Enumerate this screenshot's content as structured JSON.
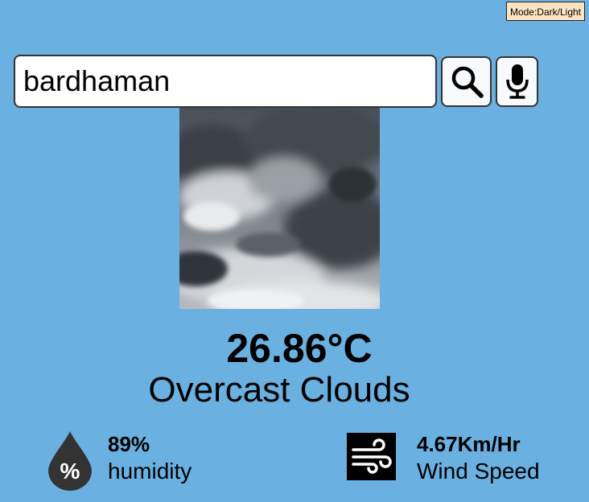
{
  "mode_toggle": {
    "label": "Mode:Dark/Light"
  },
  "search": {
    "value": "bardhaman"
  },
  "buttons": {
    "search_icon": "magnifier",
    "mic_icon": "microphone"
  },
  "weather": {
    "image": "overcast-clouds-photo",
    "temperature": "26.86°C",
    "description": "Overcast Clouds"
  },
  "humidity": {
    "value": "89%",
    "label": "humidity",
    "icon": "humidity-drop-percent"
  },
  "wind": {
    "value": "4.67Km/Hr",
    "label": "Wind Speed",
    "icon": "wind"
  },
  "colors": {
    "background": "#6ab0e0",
    "mode_toggle_bg": "#fde3c2"
  }
}
